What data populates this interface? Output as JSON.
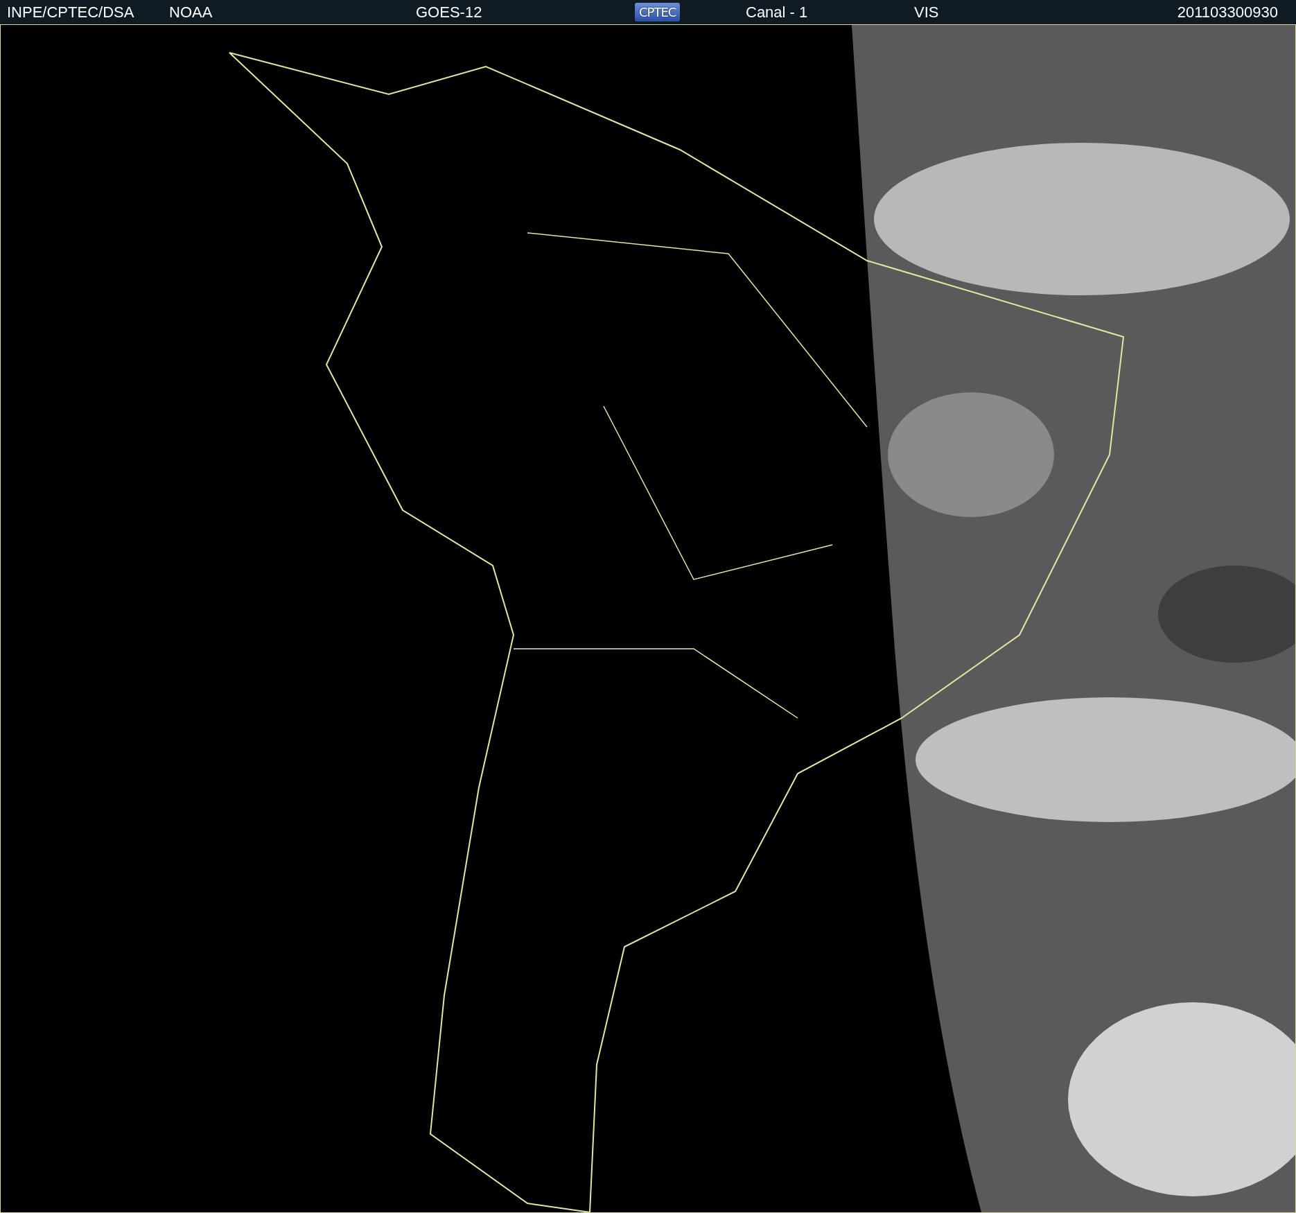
{
  "header": {
    "items": [
      {
        "kind": "text",
        "text": "INPE/CPTEC/DSA"
      },
      {
        "kind": "text",
        "text": "NOAA"
      },
      {
        "kind": "text",
        "text": "GOES-12"
      },
      {
        "kind": "logo",
        "text": "CPTEC"
      },
      {
        "kind": "text",
        "text": "Canal - 1"
      },
      {
        "kind": "text",
        "text": "VIS"
      },
      {
        "kind": "text",
        "text": "201103300930"
      }
    ]
  }
}
